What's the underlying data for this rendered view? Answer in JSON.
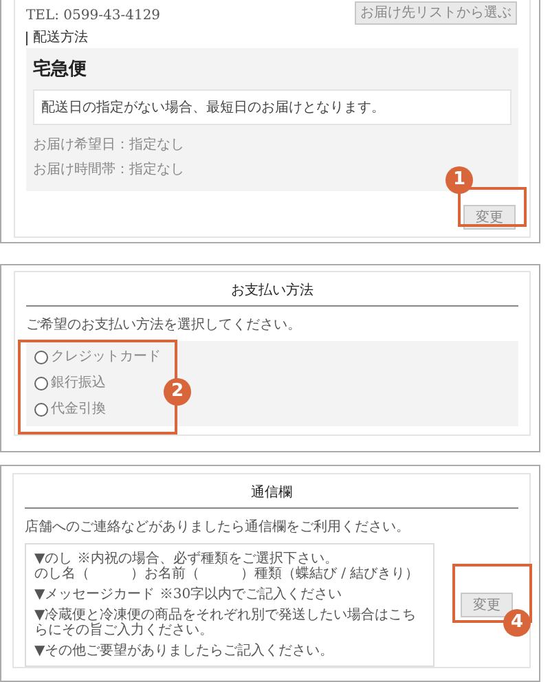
{
  "delivery": {
    "tel": "TEL: 0599-43-4129",
    "address_list_button": "お届け先リストから選ぶ",
    "section_label": "配送方法",
    "method": "宅急便",
    "notice": "配送日の指定がない場合、最短日のお届けとなります。",
    "details": [
      "お届け希望日：指定なし",
      "お届け時間帯：指定なし"
    ],
    "change_button": "変更",
    "callout": "1"
  },
  "payment": {
    "title": "お支払い方法",
    "instruction": "ご希望のお支払い方法を選択してください。",
    "options": [
      {
        "label": "クレジットカード",
        "selected": false
      },
      {
        "label": "銀行振込",
        "selected": false
      },
      {
        "label": "代金引換",
        "selected": false
      }
    ],
    "callout": "2"
  },
  "message": {
    "title": "通信欄",
    "instruction": "店舗へのご連絡などがありましたら通信欄をご利用ください。",
    "notes": [
      [
        "▼のし ※内祝の場合、必ず種類をご選択下さい。",
        "のし名（　　　）お名前（　　　）種類（蝶結び / 結びきり）"
      ],
      [
        "▼メッセージカード ※30字以内でご記入ください"
      ],
      [
        "▼冷蔵便と冷凍便の商品をそれぞれ別で発送したい場合はこちらにその旨ご入力ください。"
      ],
      [
        "▼その他ご要望がありましたらご記入ください。"
      ]
    ],
    "change_button": "変更",
    "callout": "4"
  }
}
